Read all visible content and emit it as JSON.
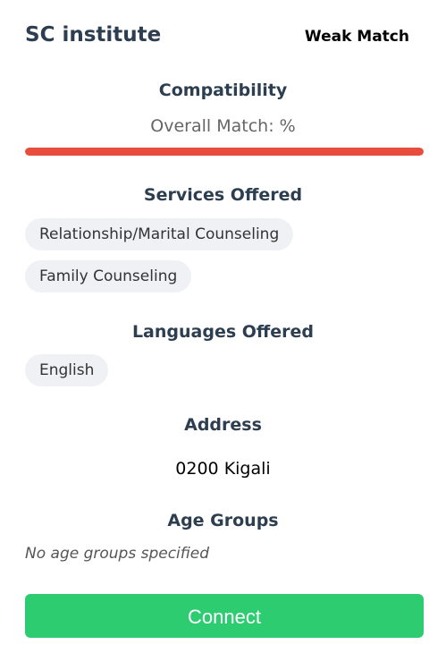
{
  "header": {
    "title": "SC institute",
    "match_label": "Weak Match"
  },
  "compatibility": {
    "heading": "Compatibility",
    "overall_text": "Overall Match: %",
    "bar_color": "#e74c3c"
  },
  "services": {
    "heading": "Services Offered",
    "items": [
      "Relationship/Marital Counseling",
      "Family Counseling"
    ]
  },
  "languages": {
    "heading": "Languages Offered",
    "items": [
      "English"
    ]
  },
  "address": {
    "heading": "Address",
    "value": "0200 Kigali"
  },
  "age_groups": {
    "heading": "Age Groups",
    "empty_text": "No age groups specified"
  },
  "connect": {
    "label": "Connect",
    "color": "#2ecc71"
  }
}
